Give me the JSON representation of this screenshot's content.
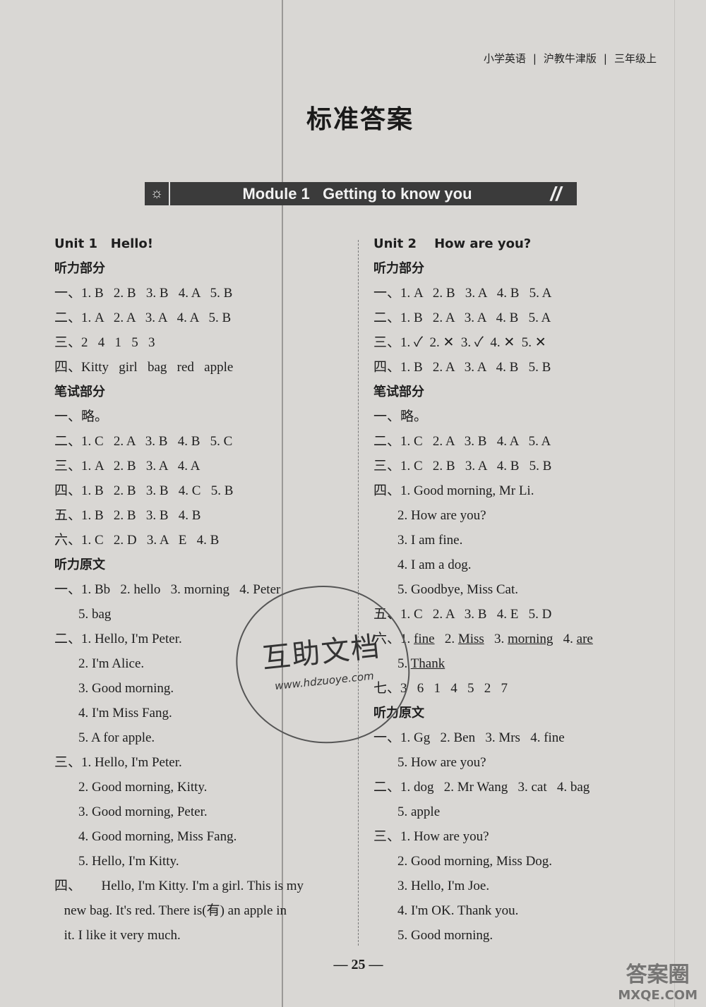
{
  "header": {
    "subject": "小学英语",
    "edition": "沪教牛津版",
    "grade": "三年级上"
  },
  "title": "标准答案",
  "module": {
    "icon": "lightbulb-icon",
    "label": "Module 1   Getting to know you"
  },
  "left_column": [
    {
      "t": "Unit 1   Hello!",
      "h": true
    },
    {
      "t": "听力部分",
      "h": true
    },
    {
      "t": "一、1. B   2. B   3. B   4. A   5. B"
    },
    {
      "t": "二、1. A   2. A   3. A   4. A   5. B"
    },
    {
      "t": "三、2   4   1   5   3"
    },
    {
      "t": "四、Kitty   girl   bag   red   apple"
    },
    {
      "t": "笔试部分",
      "h": true
    },
    {
      "t": "一、略。"
    },
    {
      "t": "二、1. C   2. A   3. B   4. B   5. C"
    },
    {
      "t": "三、1. A   2. B   3. A   4. A"
    },
    {
      "t": "四、1. B   2. B   3. B   4. C   5. B"
    },
    {
      "t": "五、1. B   2. B   3. B   4. B"
    },
    {
      "t": "六、1. C   2. D   3. A   E   4. B"
    },
    {
      "t": "听力原文",
      "h": true
    },
    {
      "t": "一、1. Bb   2. hello   3. morning   4. Peter"
    },
    {
      "t": "5. bag",
      "i": 1
    },
    {
      "t": "二、1. Hello, I'm Peter."
    },
    {
      "t": "2. I'm Alice.",
      "i": 1
    },
    {
      "t": "3. Good morning.",
      "i": 1
    },
    {
      "t": "4. I'm Miss Fang.",
      "i": 1
    },
    {
      "t": "5. A for apple.",
      "i": 1
    },
    {
      "t": "三、1. Hello, I'm Peter."
    },
    {
      "t": "2. Good morning, Kitty.",
      "i": 1
    },
    {
      "t": "3. Good morning, Peter.",
      "i": 1
    },
    {
      "t": "4. Good morning, Miss Fang.",
      "i": 1
    },
    {
      "t": "5. Hello, I'm Kitty.",
      "i": 1
    },
    {
      "t": "四、      Hello, I'm Kitty. I'm a girl. This is my"
    },
    {
      "t": "new bag. It's red. There is(有) an apple in",
      "i": 0.4
    },
    {
      "t": "it. I like it very much.",
      "i": 0.4
    }
  ],
  "right_column": [
    {
      "t": "Unit 2    How are you?",
      "h": true
    },
    {
      "t": "听力部分",
      "h": true
    },
    {
      "t": "一、1. A   2. B   3. A   4. B   5. A"
    },
    {
      "t": "二、1. B   2. A   3. A   4. B   5. A"
    },
    {
      "t": "三、1. ✓  2. ✕  3. ✓  4. ✕  5. ✕"
    },
    {
      "t": "四、1. B   2. A   3. A   4. B   5. B"
    },
    {
      "t": "笔试部分",
      "h": true
    },
    {
      "t": "一、略。"
    },
    {
      "t": "二、1. C   2. A   3. B   4. A   5. A"
    },
    {
      "t": "三、1. C   2. B   3. A   4. B   5. B"
    },
    {
      "t": "四、1. Good morning, Mr Li."
    },
    {
      "t": "2. How are you?",
      "i": 1
    },
    {
      "t": "3. I am fine.",
      "i": 1
    },
    {
      "t": "4. I am a dog.",
      "i": 1
    },
    {
      "t": "5. Goodbye, Miss Cat.",
      "i": 1
    },
    {
      "t": "五、1. C   2. A   3. B   4. E   5. D"
    },
    {
      "parts": [
        {
          "text": "六、1. "
        },
        {
          "text": "fine",
          "u": true
        },
        {
          "text": "   2. "
        },
        {
          "text": "Miss",
          "u": true
        },
        {
          "text": "   3. "
        },
        {
          "text": "morning",
          "u": true
        },
        {
          "text": "   4. "
        },
        {
          "text": "are",
          "u": true
        }
      ]
    },
    {
      "parts": [
        {
          "text": "5. "
        },
        {
          "text": "Thank",
          "u": true
        }
      ],
      "i": 1
    },
    {
      "t": "七、3   6   1   4   5   2   7"
    },
    {
      "t": "听力原文",
      "h": true
    },
    {
      "t": "一、1. Gg   2. Ben   3. Mrs   4. fine"
    },
    {
      "t": "5. How are you?",
      "i": 1
    },
    {
      "t": "二、1. dog   2. Mr Wang   3. cat   4. bag"
    },
    {
      "t": "5. apple",
      "i": 1
    },
    {
      "t": "三、1. How are you?"
    },
    {
      "t": "2. Good morning, Miss Dog.",
      "i": 1
    },
    {
      "t": "3. Hello, I'm Joe.",
      "i": 1
    },
    {
      "t": "4. I'm OK. Thank you.",
      "i": 1
    },
    {
      "t": "5. Good morning.",
      "i": 1
    }
  ],
  "watermark": {
    "cn": "互助文档",
    "url": "www.hdzuoye.com"
  },
  "page_number": "— 25 —",
  "corner_logo": {
    "cn": "答案圈",
    "url": "MXQE.COM"
  }
}
